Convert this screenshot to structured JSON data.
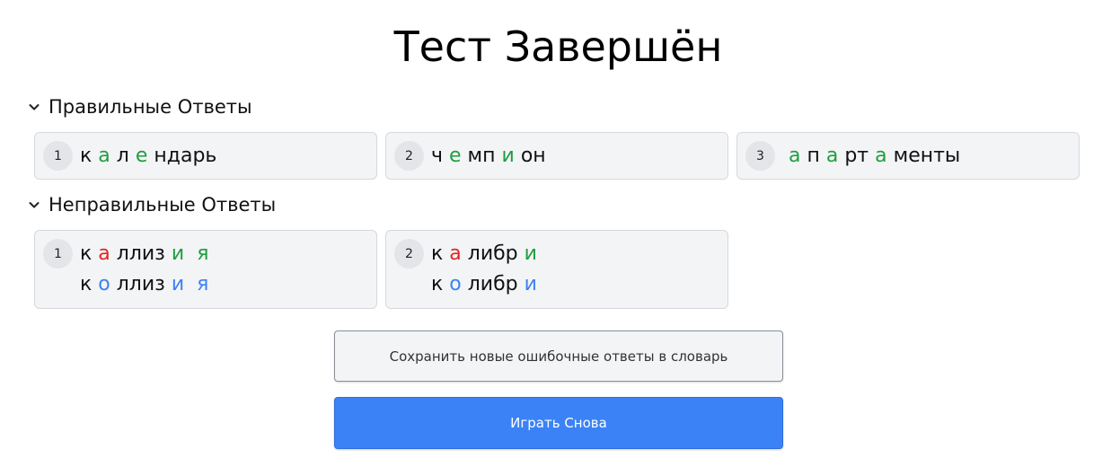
{
  "title": "Тест Завершён",
  "colors": {
    "correct_letter": "#1e9e3e",
    "wrong_letter": "#e02424",
    "expected_letter": "#3b82f6",
    "primary_button": "#3b82f6"
  },
  "correct_section": {
    "label": "Правильные Ответы",
    "icon": "chevron-down-icon",
    "items": [
      {
        "number": "1",
        "parts": [
          {
            "text": "к ",
            "style": "normal"
          },
          {
            "text": "а",
            "style": "green"
          },
          {
            "text": " л ",
            "style": "normal"
          },
          {
            "text": "е",
            "style": "green"
          },
          {
            "text": " ндарь",
            "style": "normal"
          }
        ]
      },
      {
        "number": "2",
        "parts": [
          {
            "text": "ч ",
            "style": "normal"
          },
          {
            "text": "е",
            "style": "green"
          },
          {
            "text": " мп ",
            "style": "normal"
          },
          {
            "text": "и",
            "style": "green"
          },
          {
            "text": " он",
            "style": "normal"
          }
        ]
      },
      {
        "number": "3",
        "parts": [
          {
            "text": " ",
            "style": "normal"
          },
          {
            "text": "а",
            "style": "green"
          },
          {
            "text": " п ",
            "style": "normal"
          },
          {
            "text": "а",
            "style": "green"
          },
          {
            "text": " рт ",
            "style": "normal"
          },
          {
            "text": "а",
            "style": "green"
          },
          {
            "text": " менты",
            "style": "normal"
          }
        ]
      }
    ]
  },
  "wrong_section": {
    "label": "Неправильные Ответы",
    "icon": "chevron-down-icon",
    "items": [
      {
        "number": "1",
        "answer": [
          {
            "text": "к ",
            "style": "normal"
          },
          {
            "text": "а",
            "style": "red"
          },
          {
            "text": " ллиз ",
            "style": "normal"
          },
          {
            "text": "и",
            "style": "green"
          },
          {
            "text": "  ",
            "style": "normal"
          },
          {
            "text": "я",
            "style": "green"
          }
        ],
        "correct": [
          {
            "text": "к ",
            "style": "normal"
          },
          {
            "text": "о",
            "style": "blue"
          },
          {
            "text": " ллиз ",
            "style": "normal"
          },
          {
            "text": "и",
            "style": "blue"
          },
          {
            "text": "  ",
            "style": "normal"
          },
          {
            "text": "я",
            "style": "blue"
          }
        ]
      },
      {
        "number": "2",
        "answer": [
          {
            "text": "к ",
            "style": "normal"
          },
          {
            "text": "а",
            "style": "red"
          },
          {
            "text": " либр ",
            "style": "normal"
          },
          {
            "text": "и",
            "style": "green"
          }
        ],
        "correct": [
          {
            "text": "к ",
            "style": "normal"
          },
          {
            "text": "о",
            "style": "blue"
          },
          {
            "text": " либр ",
            "style": "normal"
          },
          {
            "text": "и",
            "style": "blue"
          }
        ]
      }
    ]
  },
  "buttons": {
    "save_label": "Сохранить новые ошибочные ответы в словарь",
    "play_label": "Играть Снова"
  }
}
